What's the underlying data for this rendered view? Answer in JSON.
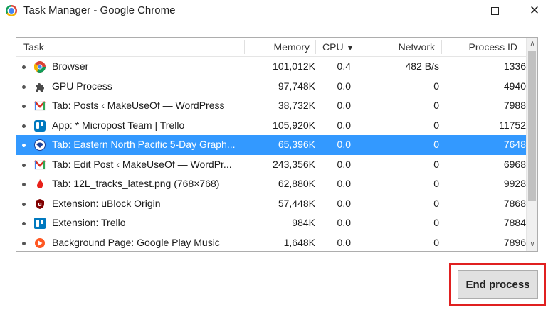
{
  "window": {
    "title": "Task Manager - Google Chrome"
  },
  "columns": {
    "task": "Task",
    "memory": "Memory",
    "cpu": "CPU",
    "cpu_sort": "▼",
    "network": "Network",
    "pid": "Process ID"
  },
  "rows": [
    {
      "icon": "chrome-icon",
      "name": "Browser",
      "memory": "101,012K",
      "cpu": "0.4",
      "network": "482 B/s",
      "pid": "1336"
    },
    {
      "icon": "puzzle-icon",
      "name": "GPU Process",
      "memory": "97,748K",
      "cpu": "0.0",
      "network": "0",
      "pid": "4940"
    },
    {
      "icon": "wordpress-mail-icon",
      "name": "Tab: Posts ‹ MakeUseOf — WordPress",
      "memory": "38,732K",
      "cpu": "0.0",
      "network": "0",
      "pid": "7988"
    },
    {
      "icon": "trello-app-icon",
      "name": "App: * Micropost Team | Trello",
      "memory": "105,920K",
      "cpu": "0.0",
      "network": "0",
      "pid": "11752"
    },
    {
      "icon": "noaa-icon",
      "name": "Tab: Eastern North Pacific 5-Day Graph...",
      "memory": "65,396K",
      "cpu": "0.0",
      "network": "0",
      "pid": "7648",
      "selected": true
    },
    {
      "icon": "wordpress-mail-icon",
      "name": "Tab: Edit Post ‹ MakeUseOf — WordPr...",
      "memory": "243,356K",
      "cpu": "0.0",
      "network": "0",
      "pid": "6968"
    },
    {
      "icon": "flame-icon",
      "name": "Tab: 12L_tracks_latest.png (768×768)",
      "memory": "62,880K",
      "cpu": "0.0",
      "network": "0",
      "pid": "9928"
    },
    {
      "icon": "ublock-icon",
      "name": "Extension: uBlock Origin",
      "memory": "57,448K",
      "cpu": "0.0",
      "network": "0",
      "pid": "7868"
    },
    {
      "icon": "trello-icon",
      "name": "Extension: Trello",
      "memory": "984K",
      "cpu": "0.0",
      "network": "0",
      "pid": "7884"
    },
    {
      "icon": "play-music-icon",
      "name": "Background Page: Google Play Music",
      "memory": "1,648K",
      "cpu": "0.0",
      "network": "0",
      "pid": "7896"
    }
  ],
  "buttons": {
    "end_process": "End process"
  },
  "colors": {
    "selection": "#3399ff",
    "highlight": "#e02020"
  }
}
